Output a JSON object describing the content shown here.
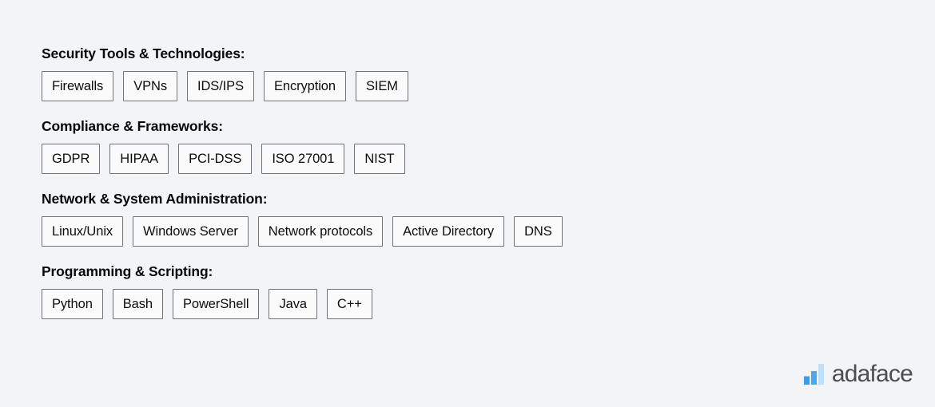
{
  "page": {
    "background_color": "#f3f4f6",
    "heading_color": "#08090a",
    "tag_border_color": "#6f7277",
    "tag_background_color": "#fbfbfc",
    "tag_text_color": "#0c0d0e"
  },
  "sections": [
    {
      "heading": "Security Tools & Technologies:",
      "tags": [
        "Firewalls",
        "VPNs",
        "IDS/IPS",
        "Encryption",
        "SIEM"
      ]
    },
    {
      "heading": "Compliance & Frameworks:",
      "tags": [
        "GDPR",
        "HIPAA",
        "PCI-DSS",
        "ISO 27001",
        "NIST"
      ]
    },
    {
      "heading": "Network & System Administration:",
      "tags": [
        "Linux/Unix",
        "Windows Server",
        "Network protocols",
        "Active Directory",
        "DNS"
      ]
    },
    {
      "heading": "Programming & Scripting:",
      "tags": [
        "Python",
        "Bash",
        "PowerShell",
        "Java",
        "C++"
      ]
    }
  ],
  "logo": {
    "icon": "bar-chart-icon",
    "wordmark": "adaface",
    "wordmark_color": "#4b4d52",
    "bar_colors": [
      "#3d9be9",
      "#45aaf2",
      "#bfdffb"
    ]
  }
}
